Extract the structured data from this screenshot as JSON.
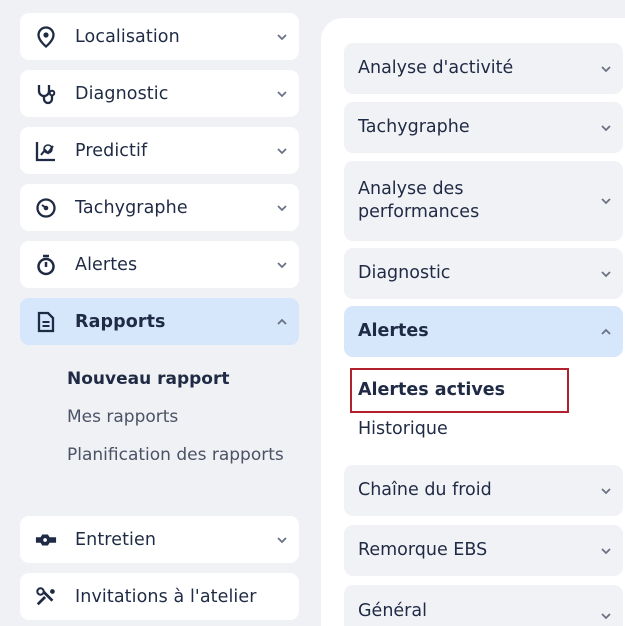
{
  "sidebar": {
    "items": [
      {
        "label": "Localisation",
        "icon": "location-pin-icon"
      },
      {
        "label": "Diagnostic",
        "icon": "stethoscope-icon"
      },
      {
        "label": "Predictif",
        "icon": "predictive-chart-icon"
      },
      {
        "label": "Tachygraphe",
        "icon": "tachograph-icon"
      },
      {
        "label": "Alertes",
        "icon": "stopwatch-icon"
      },
      {
        "label": "Rapports",
        "icon": "document-icon"
      },
      {
        "label": "Entretien",
        "icon": "wrench-icon"
      },
      {
        "label": "Invitations à l'atelier",
        "icon": "workshop-tools-icon"
      }
    ],
    "rapports_sub": [
      "Nouveau rapport",
      "Mes rapports",
      "Planification des rapports"
    ]
  },
  "panel": {
    "items": [
      "Analyse d'activité",
      "Tachygraphe",
      "Analyse des performances",
      "Diagnostic",
      "Alertes",
      "Chaîne du froid",
      "Remorque EBS",
      "Général"
    ],
    "alertes_sub": [
      "Alertes actives",
      "Historique"
    ]
  },
  "colors": {
    "active_bg": "#d6e6fb",
    "highlight_border": "#b3202e",
    "text": "#1f2a44"
  }
}
